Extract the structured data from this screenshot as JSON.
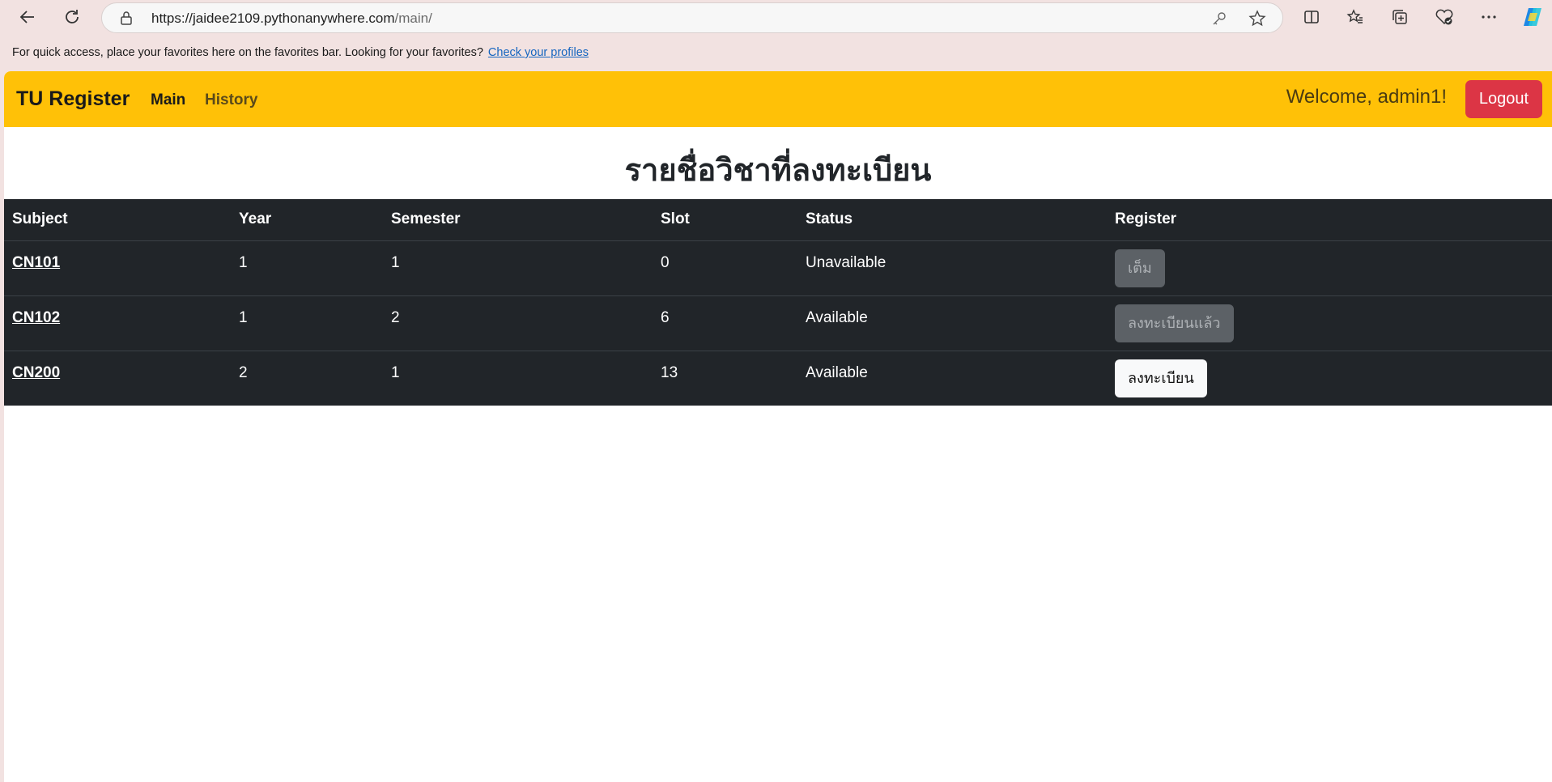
{
  "browser": {
    "url_host": "https://jaidee2109.pythonanywhere.com",
    "url_path": "/main/",
    "favorites_text": "For quick access, place your favorites here on the favorites bar. Looking for your favorites?",
    "favorites_link": "Check your profiles"
  },
  "navbar": {
    "brand": "TU Register",
    "links": [
      "Main",
      "History"
    ],
    "welcome": "Welcome, admin1!",
    "logout": "Logout",
    "color": "#ffc107",
    "logout_color": "#dc3545"
  },
  "page": {
    "title": "รายชื่อวิชาที่ลงทะเบียน"
  },
  "table": {
    "headers": [
      "Subject",
      "Year",
      "Semester",
      "Slot",
      "Status",
      "Register"
    ],
    "rows": [
      {
        "subject": "CN101",
        "year": "1",
        "semester": "1",
        "slot": "0",
        "status": "Unavailable",
        "register": "เต็ม"
      },
      {
        "subject": "CN102",
        "year": "1",
        "semester": "2",
        "slot": "6",
        "status": "Available",
        "register": "ลงทะเบียนแล้ว"
      },
      {
        "subject": "CN200",
        "year": "2",
        "semester": "1",
        "slot": "13",
        "status": "Available",
        "register": "ลงทะเบียน"
      }
    ]
  }
}
